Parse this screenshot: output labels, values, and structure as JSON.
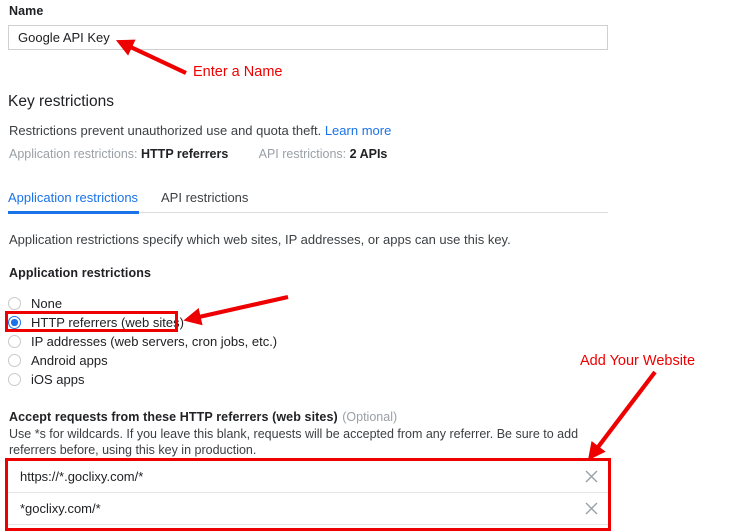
{
  "name_section": {
    "label": "Name",
    "value": "Google API Key",
    "placeholder": "Name"
  },
  "key_restrictions": {
    "title": "Key restrictions",
    "description": "Restrictions prevent unauthorized use and quota theft.",
    "learn_more": "Learn more",
    "summary": {
      "application_label": "Application restrictions:",
      "application_value": "HTTP referrers",
      "api_label": "API restrictions:",
      "api_value": "2 APIs"
    }
  },
  "tabs": {
    "application": "Application restrictions",
    "api": "API restrictions",
    "active": "application"
  },
  "application_restrictions": {
    "description": "Application restrictions specify which web sites, IP addresses, or apps can use this key.",
    "heading": "Application restrictions",
    "options": [
      {
        "label": "None",
        "selected": false
      },
      {
        "label": "HTTP referrers (web sites)",
        "selected": true
      },
      {
        "label": "IP addresses (web servers, cron jobs, etc.)",
        "selected": false
      },
      {
        "label": "Android apps",
        "selected": false
      },
      {
        "label": "iOS apps",
        "selected": false
      }
    ]
  },
  "accept_requests": {
    "heading": "Accept requests from these HTTP referrers (web sites)",
    "optional": "(Optional)",
    "help": "Use *s for wildcards. If you leave this blank, requests will be accepted from any referrer. Be sure to add referrers before, using this key in production.",
    "referrers": [
      {
        "value": "https://*.goclixy.com/*",
        "clear_icon": "close-icon"
      },
      {
        "value": "*goclixy.com/*",
        "clear_icon": "close-icon"
      }
    ]
  },
  "annotations": {
    "color": "#ee0000",
    "enter_name": "Enter a Name",
    "add_website": "Add Your Website"
  },
  "colors": {
    "accent": "#1a73e8",
    "text": "#202124",
    "muted": "#9aa0a6",
    "annotation": "#ee0000"
  }
}
